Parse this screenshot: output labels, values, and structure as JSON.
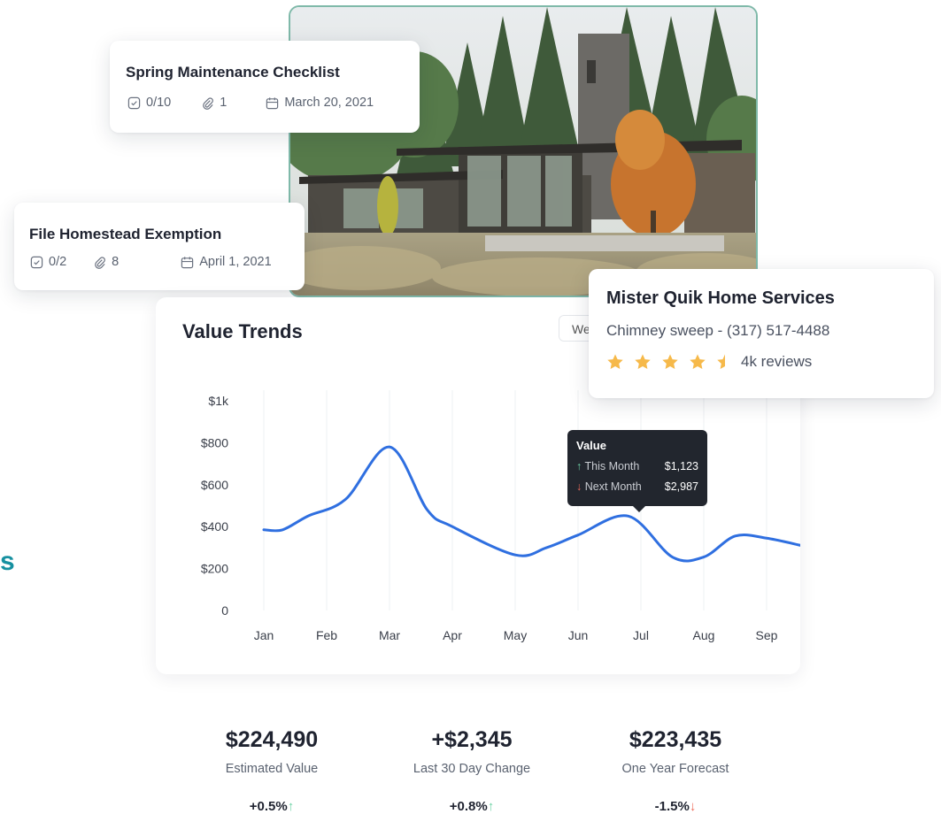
{
  "side_text": "s",
  "tasks": [
    {
      "title": "Spring Maintenance Checklist",
      "checks": "0/10",
      "attachments": "1",
      "date": "March 20, 2021"
    },
    {
      "title": "File Homestead Exemption",
      "checks": "0/2",
      "attachments": "8",
      "date": "April 1, 2021"
    }
  ],
  "service": {
    "name": "Mister Quik Home Services",
    "detail": "Chimney sweep - (317) 517-4488",
    "rating": 4.5,
    "reviews": "4k reviews"
  },
  "chart_panel": {
    "title": "Value Trends",
    "period_button": "We"
  },
  "tooltip": {
    "title": "Value",
    "rows": [
      {
        "label": "This Month",
        "value": "$1,123",
        "direction": "up"
      },
      {
        "label": "Next Month",
        "value": "$2,987",
        "direction": "down"
      }
    ]
  },
  "chart_data": {
    "type": "line",
    "title": "Value Trends",
    "categories": [
      "Jan",
      "Feb",
      "Mar",
      "Apr",
      "May",
      "Jun",
      "Jul",
      "Aug",
      "Sep"
    ],
    "y_tick_labels": [
      "0",
      "$200",
      "$400",
      "$600",
      "$800",
      "$1k"
    ],
    "y_ticks": [
      0,
      200,
      400,
      600,
      800,
      1000
    ],
    "ylim": [
      0,
      1000
    ],
    "grid": "vertical",
    "series": [
      {
        "color": "#2f6fe0",
        "x": [
          0,
          0.3,
          0.7,
          1.3,
          2.0,
          2.6,
          3.0,
          4.0,
          4.5,
          5.0,
          5.8,
          6.5,
          7.0,
          7.5,
          8.0,
          8.55
        ],
        "y": [
          385,
          385,
          450,
          530,
          780,
          480,
          400,
          265,
          300,
          360,
          450,
          255,
          255,
          355,
          345,
          310
        ]
      }
    ]
  },
  "stats": [
    {
      "value": "$224,490",
      "label": "Estimated Value",
      "change": "+0.5%",
      "arrow": "↑",
      "direction": "up"
    },
    {
      "value": "+$2,345",
      "label": "Last 30 Day Change",
      "change": "+0.8%",
      "arrow": "↑",
      "direction": "up"
    },
    {
      "value": "$223,435",
      "label": "One Year Forecast",
      "change": "-1.5%",
      "arrow": "↓",
      "direction": "down"
    }
  ],
  "colors": {
    "accent_teal": "#1690a0",
    "line_blue": "#2f6fe0",
    "star": "#f6b94a",
    "up": "#6fd3a7",
    "down": "#ee6b5a"
  }
}
